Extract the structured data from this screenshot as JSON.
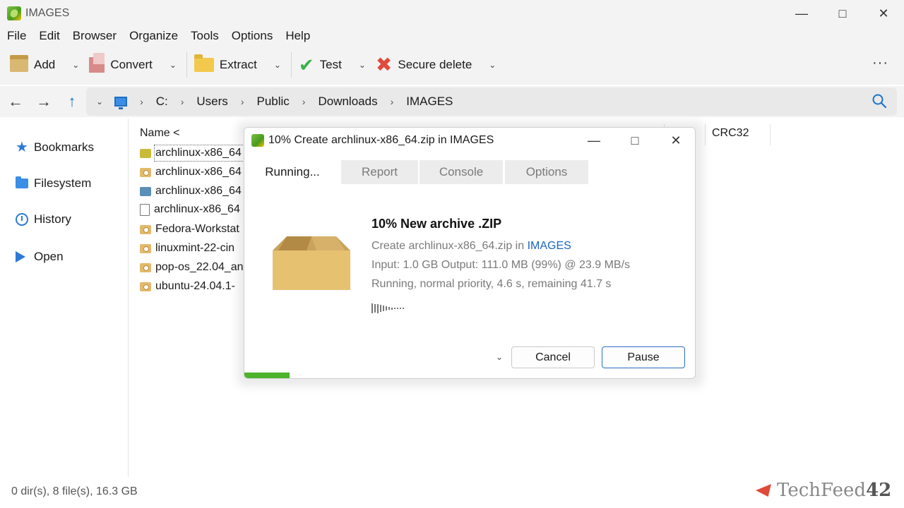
{
  "window": {
    "title": "IMAGES"
  },
  "menu": [
    "File",
    "Edit",
    "Browser",
    "Organize",
    "Tools",
    "Options",
    "Help"
  ],
  "toolbar": {
    "add": "Add",
    "convert": "Convert",
    "extract": "Extract",
    "test": "Test",
    "secure_delete": "Secure delete",
    "more": "···"
  },
  "breadcrumb": [
    "C:",
    "Users",
    "Public",
    "Downloads",
    "IMAGES"
  ],
  "sidebar": [
    "Bookmarks",
    "Filesystem",
    "History",
    "Open"
  ],
  "filelist": {
    "name_header": "Name <",
    "crc_header": "CRC32",
    "truncated_header": "...",
    "files": [
      {
        "name": "archlinux-x86_64",
        "icon": "zip-icon"
      },
      {
        "name": "archlinux-x86_64",
        "icon": "disc-image-icon"
      },
      {
        "name": "archlinux-x86_64",
        "icon": "blue-archive-icon"
      },
      {
        "name": "archlinux-x86_64",
        "icon": "file-icon"
      },
      {
        "name": "Fedora-Workstat",
        "icon": "disc-image-icon"
      },
      {
        "name": "linuxmint-22-cin",
        "icon": "disc-image-icon"
      },
      {
        "name": "pop-os_22.04_an",
        "icon": "disc-image-icon"
      },
      {
        "name": "ubuntu-24.04.1-",
        "icon": "disc-image-icon"
      }
    ]
  },
  "status": {
    "text": "0 dir(s), 8 file(s), 16.3 GB"
  },
  "watermark": {
    "text_a": "TechFeed",
    "text_b": "42"
  },
  "dialog": {
    "title": "10% Create archlinux-x86_64.zip in IMAGES",
    "tabs": [
      "Running...",
      "Report",
      "Console",
      "Options"
    ],
    "heading": "10% New archive .ZIP",
    "create_prefix": "Create archlinux-x86_64.zip in ",
    "create_link": "IMAGES",
    "io_line": "Input: 1.0 GB   Output: 111.0 MB (99%) @ 23.9 MB/s",
    "status_line": "Running, normal priority, 4.6 s, remaining 41.7 s",
    "cancel": "Cancel",
    "pause": "Pause",
    "progress_fraction": 0.1,
    "progress_color": "#4cb32a"
  }
}
